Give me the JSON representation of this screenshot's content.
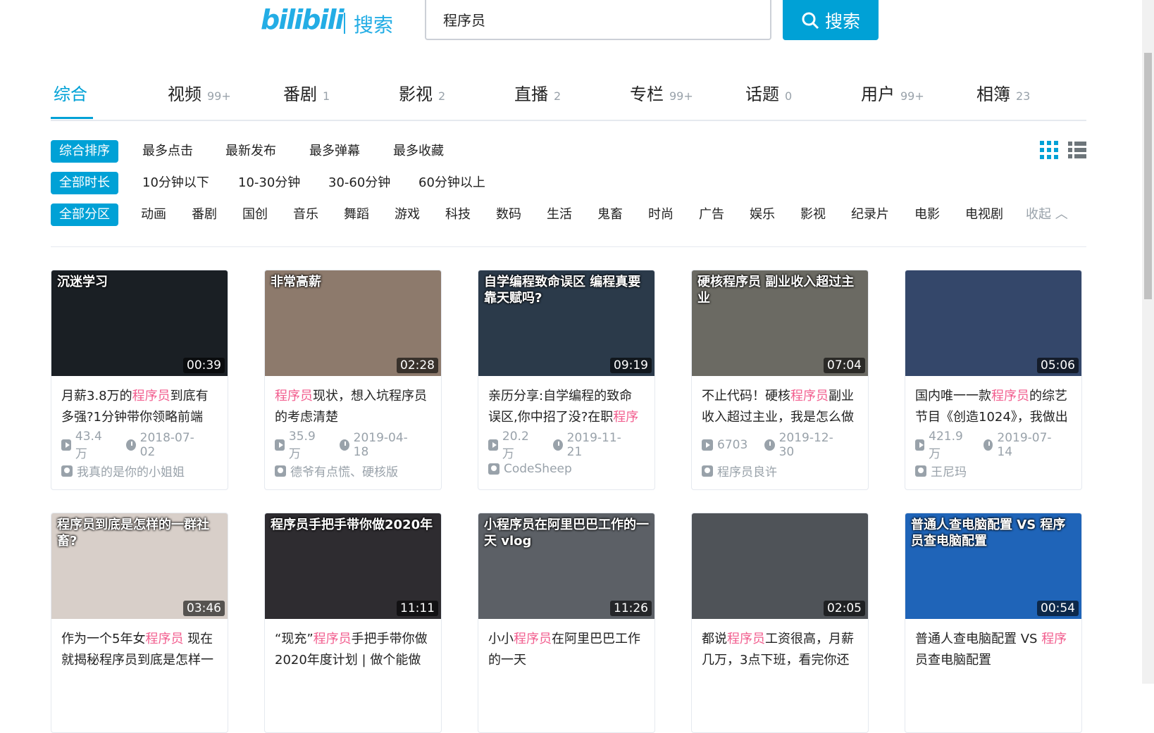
{
  "header": {
    "logo": "bilibili",
    "logo_label": "搜索",
    "search_value": "程序员",
    "search_button": "搜索"
  },
  "tabs": [
    {
      "label": "综合",
      "count": ""
    },
    {
      "label": "视频",
      "count": "99+"
    },
    {
      "label": "番剧",
      "count": "1"
    },
    {
      "label": "影视",
      "count": "2"
    },
    {
      "label": "直播",
      "count": "2"
    },
    {
      "label": "专栏",
      "count": "99+"
    },
    {
      "label": "话题",
      "count": "0"
    },
    {
      "label": "用户",
      "count": "99+"
    },
    {
      "label": "相簿",
      "count": "23"
    }
  ],
  "filters": {
    "order": [
      "综合排序",
      "最多点击",
      "最新发布",
      "最多弹幕",
      "最多收藏"
    ],
    "duration": [
      "全部时长",
      "10分钟以下",
      "10-30分钟",
      "30-60分钟",
      "60分钟以上"
    ],
    "zone": [
      "全部分区",
      "动画",
      "番剧",
      "国创",
      "音乐",
      "舞蹈",
      "游戏",
      "科技",
      "数码",
      "生活",
      "鬼畜",
      "时尚",
      "广告",
      "娱乐",
      "影视",
      "纪录片",
      "电影",
      "电视剧"
    ],
    "collapse": "收起"
  },
  "videos": [
    {
      "duration": "00:39",
      "thumb_text": "沉迷学习",
      "title_parts": [
        "月薪3.8万的",
        "程序员",
        "到底有多强?1分钟带你领略前端"
      ],
      "views": "43.4万",
      "date": "2018-07-02",
      "author": "我真的是你的小姐姐",
      "bg": "#1a1f24"
    },
    {
      "duration": "02:28",
      "thumb_text": "非常高薪",
      "title_parts": [
        "",
        "程序员",
        "现状，想入坑程序员的考虑清楚"
      ],
      "views": "35.9万",
      "date": "2019-04-18",
      "author": "德爷有点慌、硬核版",
      "bg": "#8d7a6c"
    },
    {
      "duration": "09:19",
      "thumb_text": "自学编程致命误区 编程真要靠天赋吗?",
      "title_parts": [
        "亲历分享:自学编程的致命误区,你中招了没?在职",
        "程序员",
        ""
      ],
      "views": "20.2万",
      "date": "2019-11-21",
      "author": "CodeSheep",
      "bg": "#2b3a4a"
    },
    {
      "duration": "07:04",
      "thumb_text": "硬核程序员 副业收入超过主业",
      "title_parts": [
        "不止代码！硬核",
        "程序员",
        "副业收入超过主业，我是怎么做"
      ],
      "views": "6703",
      "date": "2019-12-30",
      "author": "程序员良许",
      "bg": "#6b6a63"
    },
    {
      "duration": "05:06",
      "thumb_text": "",
      "title_parts": [
        "国内唯一一款",
        "程序员",
        "的综艺节目《创造1024》，我做出"
      ],
      "views": "421.9万",
      "date": "2019-07-14",
      "author": "王尼玛",
      "bg": "#34476a"
    },
    {
      "duration": "03:46",
      "thumb_text": "程序员到底是怎样的一群社畜?",
      "title_parts": [
        "作为一个5年女",
        "程序员",
        " 现在就揭秘程序员到底是怎样一"
      ],
      "views": "",
      "date": "",
      "author": "",
      "bg": "#d8cfc9"
    },
    {
      "duration": "11:11",
      "thumb_text": "程序员手把手带你做2020年",
      "title_parts": [
        "“现充”",
        "程序员",
        "手把手带你做2020年度计划 | 做个能做到"
      ],
      "views": "",
      "date": "",
      "author": "",
      "bg": "#2e2c30"
    },
    {
      "duration": "11:26",
      "thumb_text": "小程序员在阿里巴巴工作的一天 vlog",
      "title_parts": [
        "小小",
        "程序员",
        "在阿里巴巴工作的一天"
      ],
      "views": "",
      "date": "",
      "author": "",
      "bg": "#5c6066"
    },
    {
      "duration": "02:05",
      "thumb_text": "",
      "title_parts": [
        "都说",
        "程序员",
        "工资很高，月薪几万，3点下班，看完你还"
      ],
      "views": "",
      "date": "",
      "author": "",
      "bg": "#4f5358"
    },
    {
      "duration": "00:54",
      "thumb_text": "普通人查电脑配置 VS 程序员查电脑配置",
      "title_parts": [
        "普通人查电脑配置 VS ",
        "程序",
        "员查电脑配置"
      ],
      "views": "",
      "date": "",
      "author": "",
      "bg": "#1f64b8"
    }
  ],
  "colors": {
    "accent": "#00a1d6",
    "highlight": "#f25d8e",
    "muted": "#99a2aa"
  }
}
